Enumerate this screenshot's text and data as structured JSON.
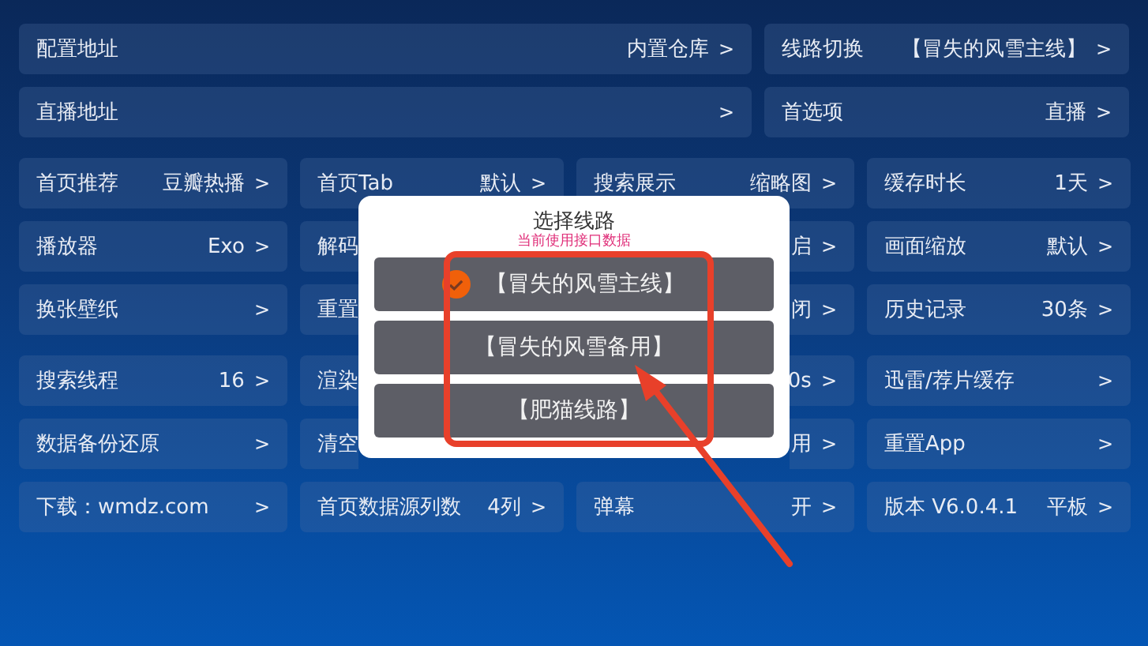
{
  "top_settings": [
    {
      "label": "配置地址",
      "value": "内置仓库",
      "chevron": ">"
    },
    {
      "label": "线路切换",
      "value": "【冒失的风雪主线】",
      "chevron": ">"
    },
    {
      "label": "直播地址",
      "chevron": ">"
    },
    {
      "label": "首选项",
      "value": "直播",
      "chevron": ">"
    }
  ],
  "setting_groups": [
    [
      {
        "label": "首页推荐",
        "value": "豆瓣热播",
        "chevron": ">"
      },
      {
        "label": "首页Tab",
        "value": "默认",
        "chevron": ">"
      },
      {
        "label": "搜索展示",
        "value": "缩略图",
        "chevron": ">"
      },
      {
        "label": "缓存时长",
        "value": "1天",
        "chevron": ">"
      },
      {
        "label": "播放器",
        "value": "Exo",
        "chevron": ">"
      },
      {
        "label": "解码"
      },
      {
        "value": "启",
        "chevron": ">"
      },
      {
        "label": "画面缩放",
        "value": "默认",
        "chevron": ">"
      },
      {
        "label": "换张壁纸",
        "chevron": ">"
      },
      {
        "label": "重置"
      },
      {
        "value": "闭",
        "chevron": ">"
      },
      {
        "label": "历史记录",
        "value": "30条",
        "chevron": ">"
      }
    ],
    [
      {
        "label": "搜索线程",
        "value": "16",
        "chevron": ">"
      },
      {
        "label": "渲染"
      },
      {
        "value": "0s",
        "chevron": ">"
      },
      {
        "label": "迅雷/荐片缓存",
        "chevron": ">"
      },
      {
        "label": "数据备份还原",
        "chevron": ">"
      },
      {
        "label": "清空"
      },
      {
        "value": "用",
        "chevron": ">"
      },
      {
        "label": "重置App",
        "chevron": ">"
      },
      {
        "label": "下载：wmdz.com",
        "chevron": ">"
      },
      {
        "label": "首页数据源列数",
        "value": "4列",
        "chevron": ">"
      },
      {
        "label": "弹幕",
        "value": "开",
        "chevron": ">"
      },
      {
        "label": "版本 V6.0.4.1",
        "value": "平板",
        "chevron": ">"
      }
    ]
  ],
  "dialog": {
    "title": "选择线路",
    "subtitle": "当前使用接口数据",
    "options": [
      {
        "label": "【冒失的风雪主线】",
        "selected": true
      },
      {
        "label": "【冒失的风雪备用】",
        "selected": false
      },
      {
        "label": "【肥猫线路】",
        "selected": false
      }
    ]
  }
}
